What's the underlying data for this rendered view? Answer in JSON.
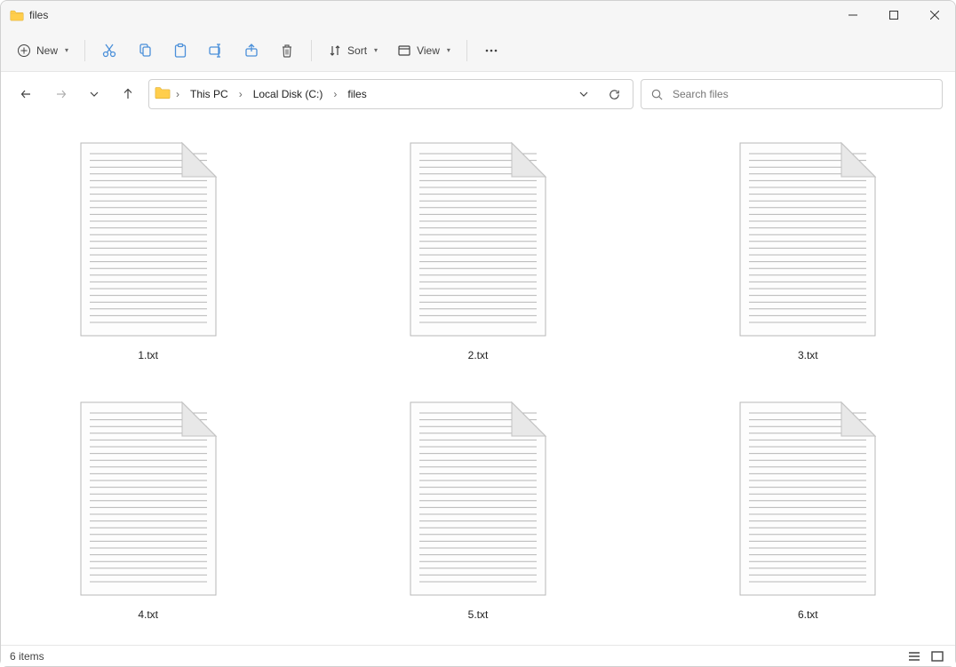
{
  "window": {
    "title": "files"
  },
  "toolbar": {
    "new_label": "New",
    "sort_label": "Sort",
    "view_label": "View"
  },
  "breadcrumbs": {
    "segment1": "This PC",
    "segment2": "Local Disk (C:)",
    "segment3": "files"
  },
  "search": {
    "placeholder": "Search files"
  },
  "files": [
    {
      "label": "1.txt"
    },
    {
      "label": "2.txt"
    },
    {
      "label": "3.txt"
    },
    {
      "label": "4.txt"
    },
    {
      "label": "5.txt"
    },
    {
      "label": "6.txt"
    }
  ],
  "status": {
    "count": "6 items"
  }
}
